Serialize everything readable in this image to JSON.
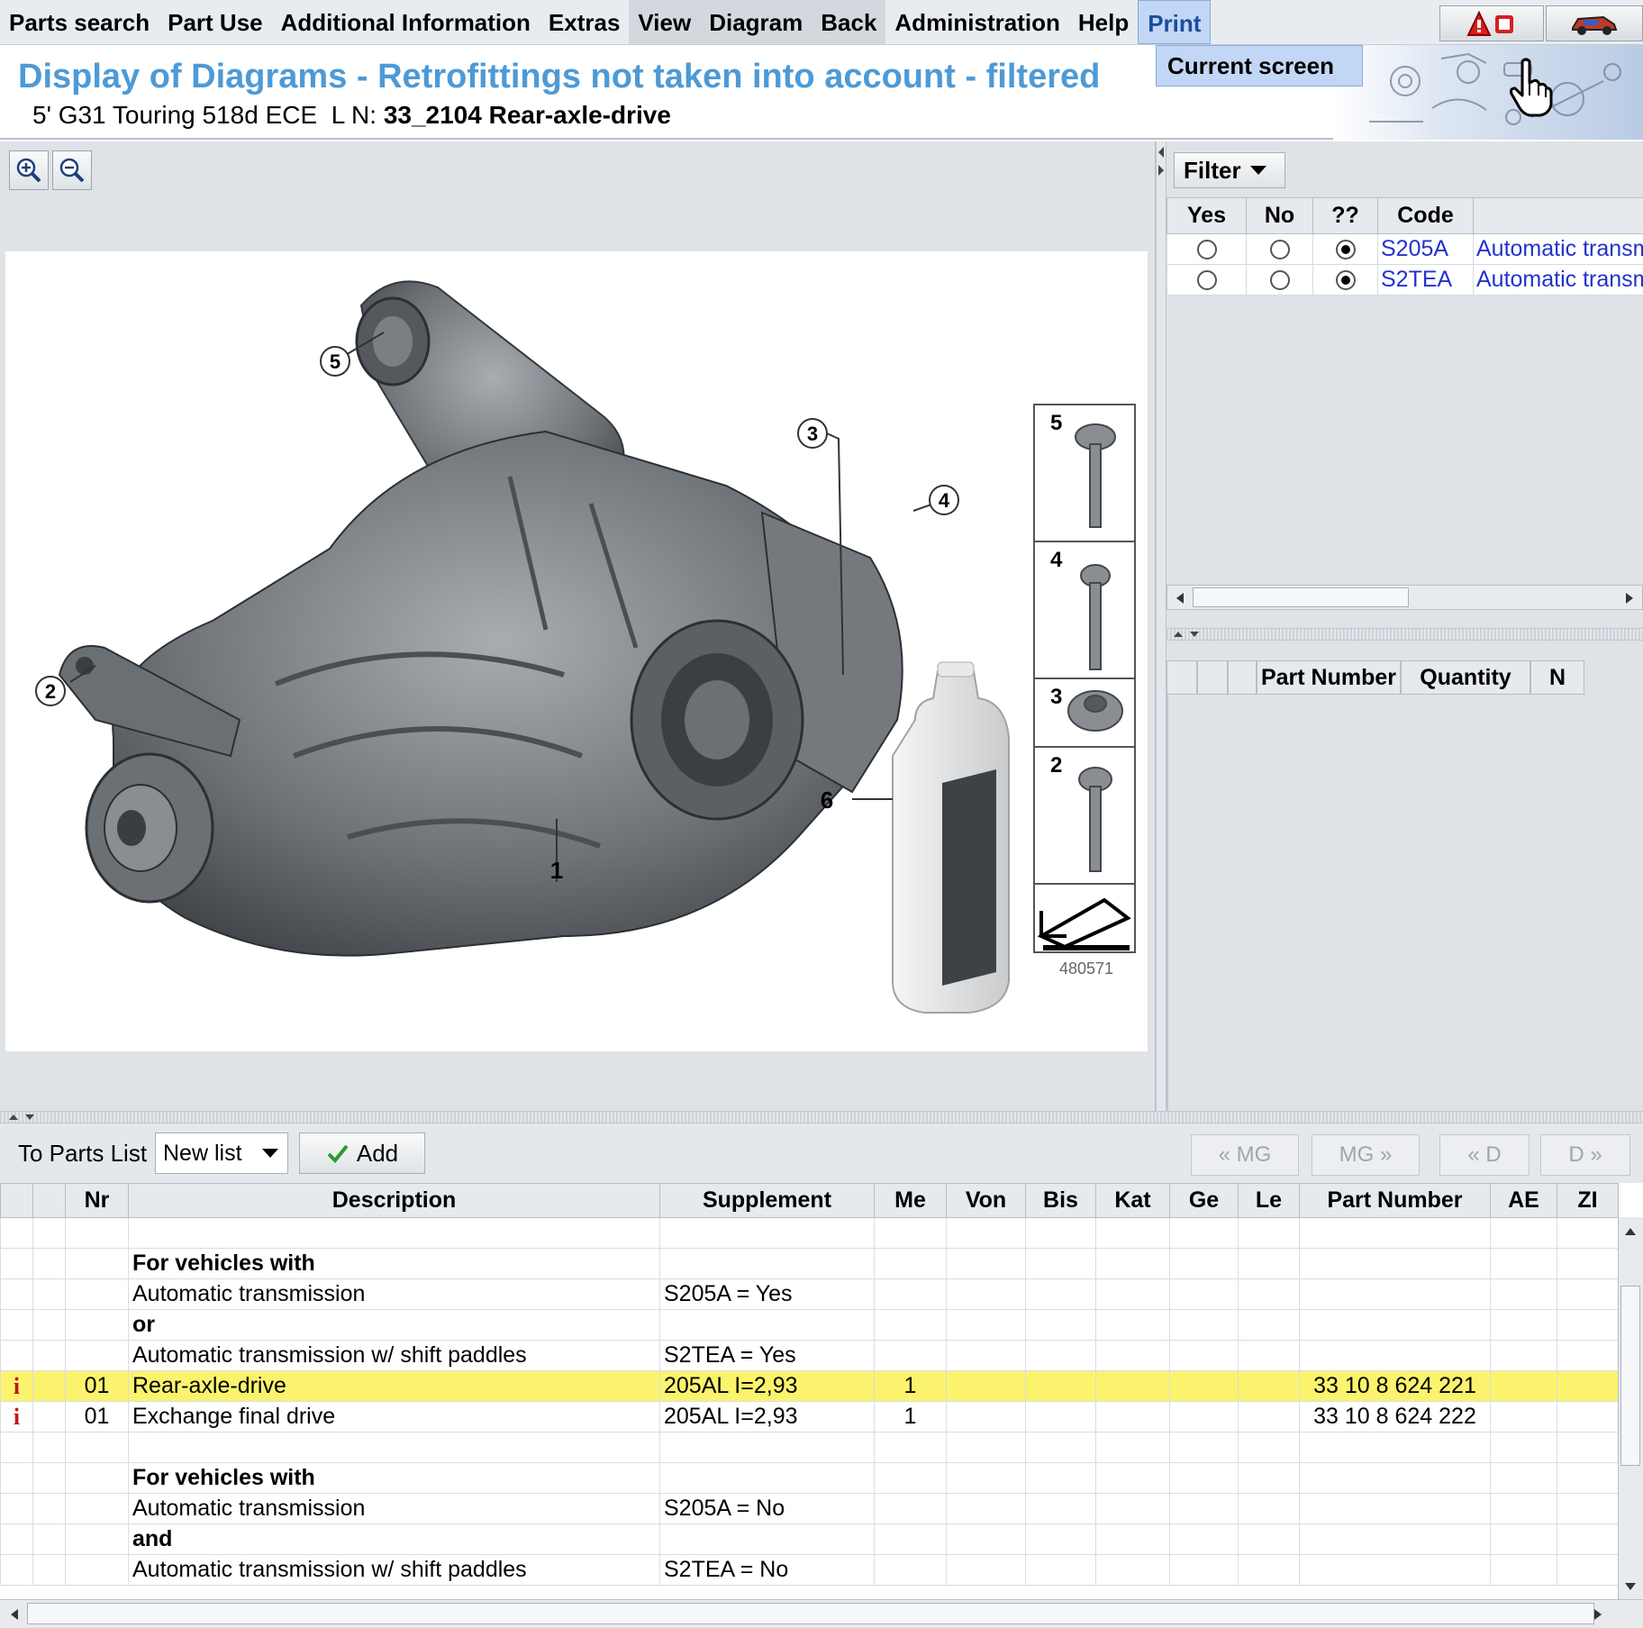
{
  "menu": {
    "items": [
      "Parts search",
      "Part Use",
      "Additional Information",
      "Extras",
      "View",
      "Diagram",
      "Back",
      "Administration",
      "Help",
      "Print"
    ],
    "print_dropdown": "Current screen"
  },
  "header": {
    "title": "Display of Diagrams - Retrofittings not taken into account - filtered",
    "vehicle": "5' G31 Touring 518d ECE",
    "ln_label": "L N:",
    "ln_value": "33_2104 Rear-axle-drive"
  },
  "diagram": {
    "callouts": [
      "1",
      "2",
      "3",
      "4",
      "5",
      "6"
    ],
    "legend_items": [
      "5",
      "4",
      "3",
      "2"
    ],
    "image_number": "480571"
  },
  "filter": {
    "button_label": "Filter",
    "columns": [
      "Yes",
      "No",
      "??",
      "Code",
      ""
    ],
    "rows": [
      {
        "code": "S205A",
        "description": "Automatic transmission",
        "selected": "??"
      },
      {
        "code": "S2TEA",
        "description": "Automatic transmission w/ shift paddles",
        "selected": "??"
      }
    ]
  },
  "parts_panel": {
    "columns": [
      "",
      "",
      "",
      "Part Number",
      "Quantity",
      "N"
    ]
  },
  "toolbar": {
    "to_parts_list": "To Parts List",
    "list_value": "New list",
    "add_label": "Add",
    "nav": [
      "« MG",
      "MG »",
      "« D",
      "D »"
    ]
  },
  "table": {
    "columns": [
      "",
      "",
      "Nr",
      "Description",
      "Supplement",
      "Me",
      "Von",
      "Bis",
      "Kat",
      "Ge",
      "Le",
      "Part Number",
      "AE",
      "ZI"
    ],
    "rows": [
      {
        "info": "",
        "nr": "",
        "desc": "",
        "supp": "",
        "me": "",
        "pn": "",
        "bold": false,
        "hl": false
      },
      {
        "info": "",
        "nr": "",
        "desc": "For vehicles with",
        "supp": "",
        "me": "",
        "pn": "",
        "bold": true,
        "hl": false
      },
      {
        "info": "",
        "nr": "",
        "desc": "Automatic transmission",
        "supp": "S205A = Yes",
        "me": "",
        "pn": "",
        "bold": false,
        "hl": false
      },
      {
        "info": "",
        "nr": "",
        "desc": "or",
        "supp": "",
        "me": "",
        "pn": "",
        "bold": true,
        "hl": false
      },
      {
        "info": "",
        "nr": "",
        "desc": "Automatic transmission w/ shift paddles",
        "supp": "S2TEA = Yes",
        "me": "",
        "pn": "",
        "bold": false,
        "hl": false
      },
      {
        "info": "i",
        "nr": "01",
        "desc": "Rear-axle-drive",
        "supp": "205AL I=2,93",
        "me": "1",
        "pn": "33 10 8 624 221",
        "bold": false,
        "hl": true
      },
      {
        "info": "i",
        "nr": "01",
        "desc": "Exchange final drive",
        "supp": "205AL I=2,93",
        "me": "1",
        "pn": "33 10 8 624 222",
        "bold": false,
        "hl": false
      },
      {
        "info": "",
        "nr": "",
        "desc": "",
        "supp": "",
        "me": "",
        "pn": "",
        "bold": false,
        "hl": false
      },
      {
        "info": "",
        "nr": "",
        "desc": "For vehicles with",
        "supp": "",
        "me": "",
        "pn": "",
        "bold": true,
        "hl": false
      },
      {
        "info": "",
        "nr": "",
        "desc": "Automatic transmission",
        "supp": "S205A = No",
        "me": "",
        "pn": "",
        "bold": false,
        "hl": false
      },
      {
        "info": "",
        "nr": "",
        "desc": "and",
        "supp": "",
        "me": "",
        "pn": "",
        "bold": true,
        "hl": false
      },
      {
        "info": "",
        "nr": "",
        "desc": "Automatic transmission w/ shift paddles",
        "supp": "S2TEA = No",
        "me": "",
        "pn": "",
        "bold": false,
        "hl": false
      }
    ]
  },
  "colors": {
    "title_blue": "#4d9ad6",
    "highlight_yellow": "#fbf36e",
    "link_blue": "#2233cc",
    "info_red": "#c01818"
  }
}
